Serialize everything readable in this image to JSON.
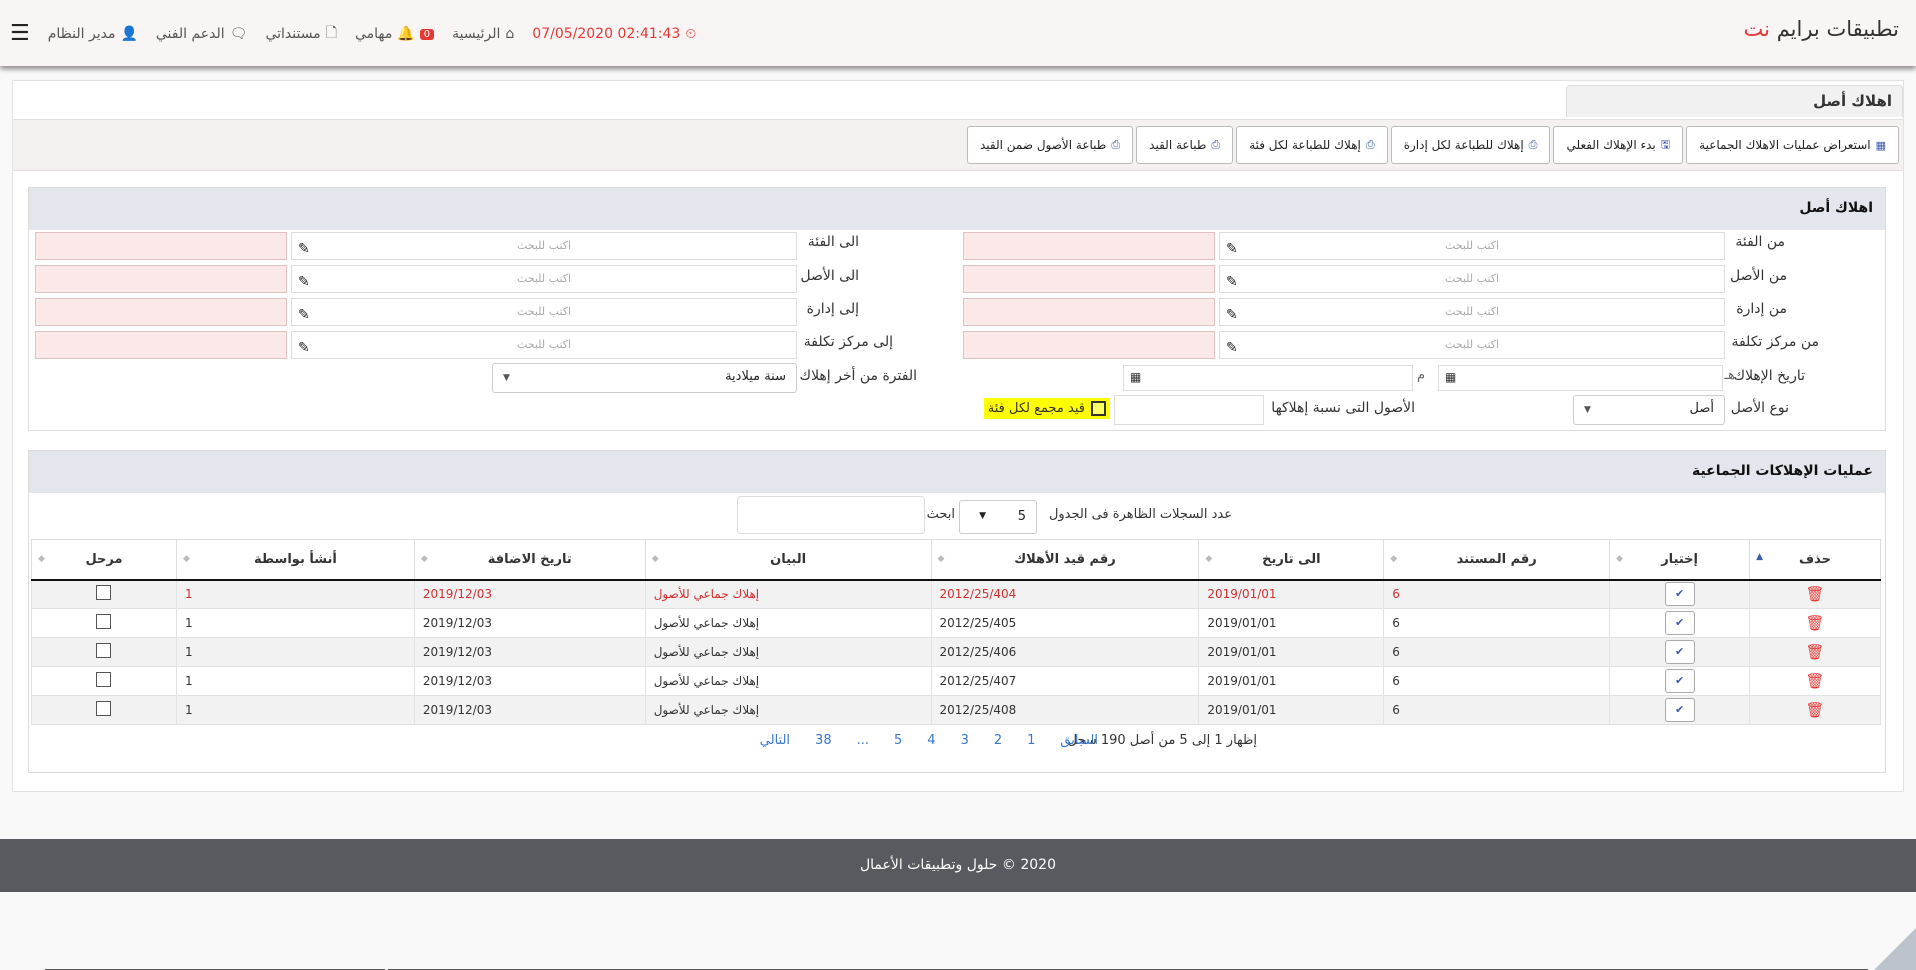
{
  "app": {
    "title_main": "تطبيقات برايم",
    "title_accent": "نت"
  },
  "topnav": {
    "datetime": "02:41:43 07/05/2020",
    "home": "الرئيسية",
    "tasks_count": "0",
    "tasks": "مهامي",
    "docs": "مستنداتي",
    "support": "الدعم الفني",
    "user": "مدير النظام"
  },
  "page": {
    "tab_title": "اهلاك أصل",
    "toolbar": {
      "b1": "استعراض عمليات الاهلاك الجماعية",
      "b2": "بدء الإهلاك الفعلي",
      "b3": "إهلاك للطباعة لكل إدارة",
      "b4": "إهلاك للطباعة لكل فئة",
      "b5": "طباعة القيد",
      "b6": "طباعة الأصول ضمن القيد"
    }
  },
  "form": {
    "title": "اهلاك أصل",
    "placeholder": "اكتب للبحث",
    "from_category": "من الفئة",
    "to_category": "الى الفئة",
    "from_asset": "من الأصل",
    "to_asset": "الى الأصل",
    "from_dept": "من إدارة",
    "to_dept": "إلى إدارة",
    "from_cost": "من مركز تكلفة",
    "to_cost": "إلى مركز تكلفة",
    "dep_date": "تاريخ الإهلاك",
    "hijri_mark": "هـ",
    "greg_mark": "م",
    "period": "الفترة من أخر إهلاك",
    "period_value": "سنة ميلادية",
    "asset_type": "نوع الأصل",
    "asset_type_value": "أصل",
    "assets_ratio": "الأصول التى نسبة إهلاكها",
    "group_entry": "قيد مجمع لكل فئة"
  },
  "ops": {
    "title": "عمليات الإهلاكات الجماعية",
    "records_label": "عدد السجلات الظاهرة فى الجدول",
    "records_value": "5",
    "search_label": "ابحث:",
    "columns": {
      "delete": "حذف",
      "select": "إختيار",
      "doc_no": "رقم المستند",
      "to_date": "الى تاريخ",
      "entry_no": "رقم قيد الأهلاك",
      "desc": "البيان",
      "added": "تاريخ الاضافة",
      "by": "أنشأ بواسطة",
      "posted": "مرحل"
    },
    "rows": [
      {
        "doc": "6",
        "to_date": "2019/01/01",
        "entry": "2012/25/404",
        "desc": "إهلاك جماعي للأصول",
        "added": "2019/12/03",
        "by": "1"
      },
      {
        "doc": "6",
        "to_date": "2019/01/01",
        "entry": "2012/25/405",
        "desc": "إهلاك جماعي للأصول",
        "added": "2019/12/03",
        "by": "1"
      },
      {
        "doc": "6",
        "to_date": "2019/01/01",
        "entry": "2012/25/406",
        "desc": "إهلاك جماعي للأصول",
        "added": "2019/12/03",
        "by": "1"
      },
      {
        "doc": "6",
        "to_date": "2019/01/01",
        "entry": "2012/25/407",
        "desc": "إهلاك جماعي للأصول",
        "added": "2019/12/03",
        "by": "1"
      },
      {
        "doc": "6",
        "to_date": "2019/01/01",
        "entry": "2012/25/408",
        "desc": "إهلاك جماعي للأصول",
        "added": "2019/12/03",
        "by": "1"
      }
    ],
    "pagination": {
      "info": "إظهار 1 إلى 5 من أصل 190 سجل",
      "prev": "السابق",
      "pages": [
        "1",
        "2",
        "3",
        "4",
        "5",
        "...",
        "38"
      ],
      "next": "التالي"
    }
  },
  "footer": {
    "text": "2020 © حلول وتطبيقات الأعمال"
  },
  "colors": {
    "accent": "#e53935",
    "link": "#3a78c9",
    "icon_blue": "#3d5ba9",
    "footer_bg": "#595a5f"
  }
}
